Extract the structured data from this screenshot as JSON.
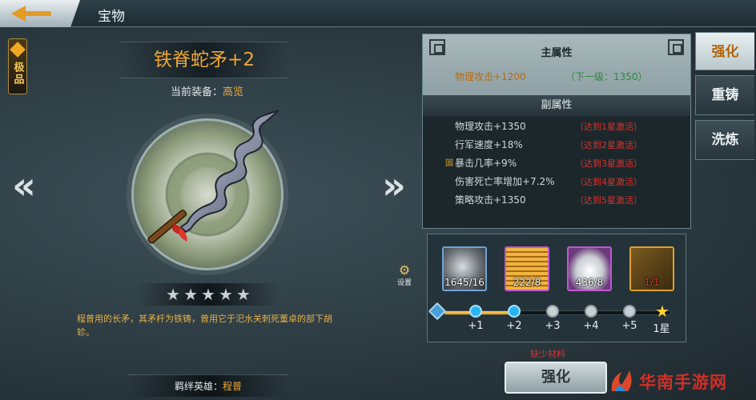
{
  "page_title": "宝物",
  "item": {
    "quality": "极品",
    "name": "铁脊蛇矛+2",
    "equip_label": "当前装备：",
    "equip_value": "高览",
    "stars": 5,
    "description": "程普用的长矛，其矛杆为铁铸，曾用它于汜水关刺死董卓的部下胡轸。",
    "hero_label": "羁绊英雄：",
    "hero_value": "程普"
  },
  "settings_label": "设置",
  "attributes": {
    "main_title": "主属性",
    "main_value": "物理攻击+1200",
    "main_next": "（下一级：1350）",
    "sub_title": "副属性",
    "sub_rows": [
      {
        "mark": "",
        "name": "物理攻击+1350",
        "cond": "（达到1星激活）"
      },
      {
        "mark": "",
        "name": "行军速度+18%",
        "cond": "（达到2星激活）"
      },
      {
        "mark": "固",
        "name": "暴击几率+9%",
        "cond": "（达到3星激活）"
      },
      {
        "mark": "",
        "name": "伤害死亡率增加+7.2%",
        "cond": "（达到4星激活）"
      },
      {
        "mark": "",
        "name": "策略攻击+1350",
        "cond": "（达到5星激活）"
      }
    ]
  },
  "materials": [
    {
      "icon": "iron-ore-icon",
      "count": "1645/16",
      "lack": false,
      "border": "#6fa4d8"
    },
    {
      "icon": "gold-coin-stack-icon",
      "count": "222/8",
      "lack": false,
      "border": "#c058d0"
    },
    {
      "icon": "silver-ingot-icon",
      "count": "436/8",
      "lack": false,
      "border": "#c058d0"
    },
    {
      "icon": "spear-fragment-icon",
      "count": "1/1",
      "lack": true,
      "border": "#e0a030"
    }
  ],
  "progress": {
    "fraction": 0.33,
    "nodes": [
      {
        "label": "",
        "state": "start"
      },
      {
        "label": "+1",
        "state": "active"
      },
      {
        "label": "+2",
        "state": "active"
      },
      {
        "label": "+3",
        "state": "inactive"
      },
      {
        "label": "+4",
        "state": "inactive"
      },
      {
        "label": "+5",
        "state": "inactive"
      },
      {
        "label": "1星",
        "state": "final"
      }
    ]
  },
  "lack_note": "缺少材料",
  "enhance_button": "强化",
  "tabs": [
    "强化",
    "重铸",
    "洗炼"
  ],
  "active_tab": 0,
  "watermark": "华南手游网",
  "colors": {
    "accent_orange": "#f0a636",
    "warning_red": "#d8332a",
    "next_green": "#2a8a3a"
  }
}
